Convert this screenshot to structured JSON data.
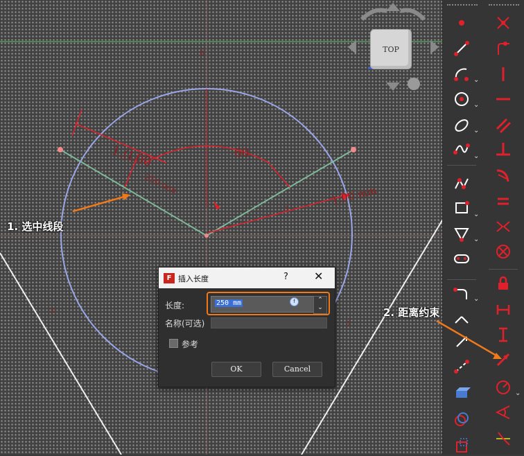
{
  "nav_cube": {
    "face_label": "TOP"
  },
  "sketch": {
    "dimensions": [
      "1.(L00",
      "60",
      "1.00 mm",
      "250 mm"
    ],
    "small_labels": [
      "8",
      "3",
      "1",
      "3"
    ]
  },
  "dialog": {
    "title": "插入长度",
    "help": "?",
    "close": "✕",
    "length_label": "长度:",
    "length_value": "250 mm",
    "name_label": "名称(可选)",
    "name_value": "",
    "reference_label": "参考",
    "reference_checked": false,
    "ok_label": "OK",
    "cancel_label": "Cancel"
  },
  "annotations": {
    "step1": "1. 选中线段",
    "step2": "2. 距离约束"
  },
  "colors": {
    "accent_orange": "#f07a1a",
    "constraint_red": "#e0202a",
    "circle_blue": "#9aa6e8",
    "line_green": "#7fb89a"
  },
  "toolbar": {
    "left_column": [
      "point-icon",
      "line-icon",
      "arc-icon",
      "circle-icon",
      "ellipse-icon",
      "bspline-icon",
      "polyline-icon",
      "rectangle-icon",
      "polygon-icon",
      "slot-icon",
      "fillet-icon",
      "trim-icon",
      "extend-icon",
      "split-icon",
      "external-geometry-icon",
      "carbon-copy-icon",
      "construction-mode-icon"
    ],
    "right_column": [
      "coincident-constraint-icon",
      "point-on-object-icon",
      "vertical-constraint-icon",
      "horizontal-constraint-icon",
      "parallel-constraint-icon",
      "perpendicular-constraint-icon",
      "tangent-constraint-icon",
      "equal-constraint-icon",
      "symmetric-constraint-icon",
      "block-constraint-icon",
      "lock-constraint-icon",
      "horizontal-distance-icon",
      "vertical-distance-icon",
      "distance-constraint-icon",
      "radius-constraint-icon",
      "angle-constraint-icon",
      "snell-law-icon"
    ]
  }
}
